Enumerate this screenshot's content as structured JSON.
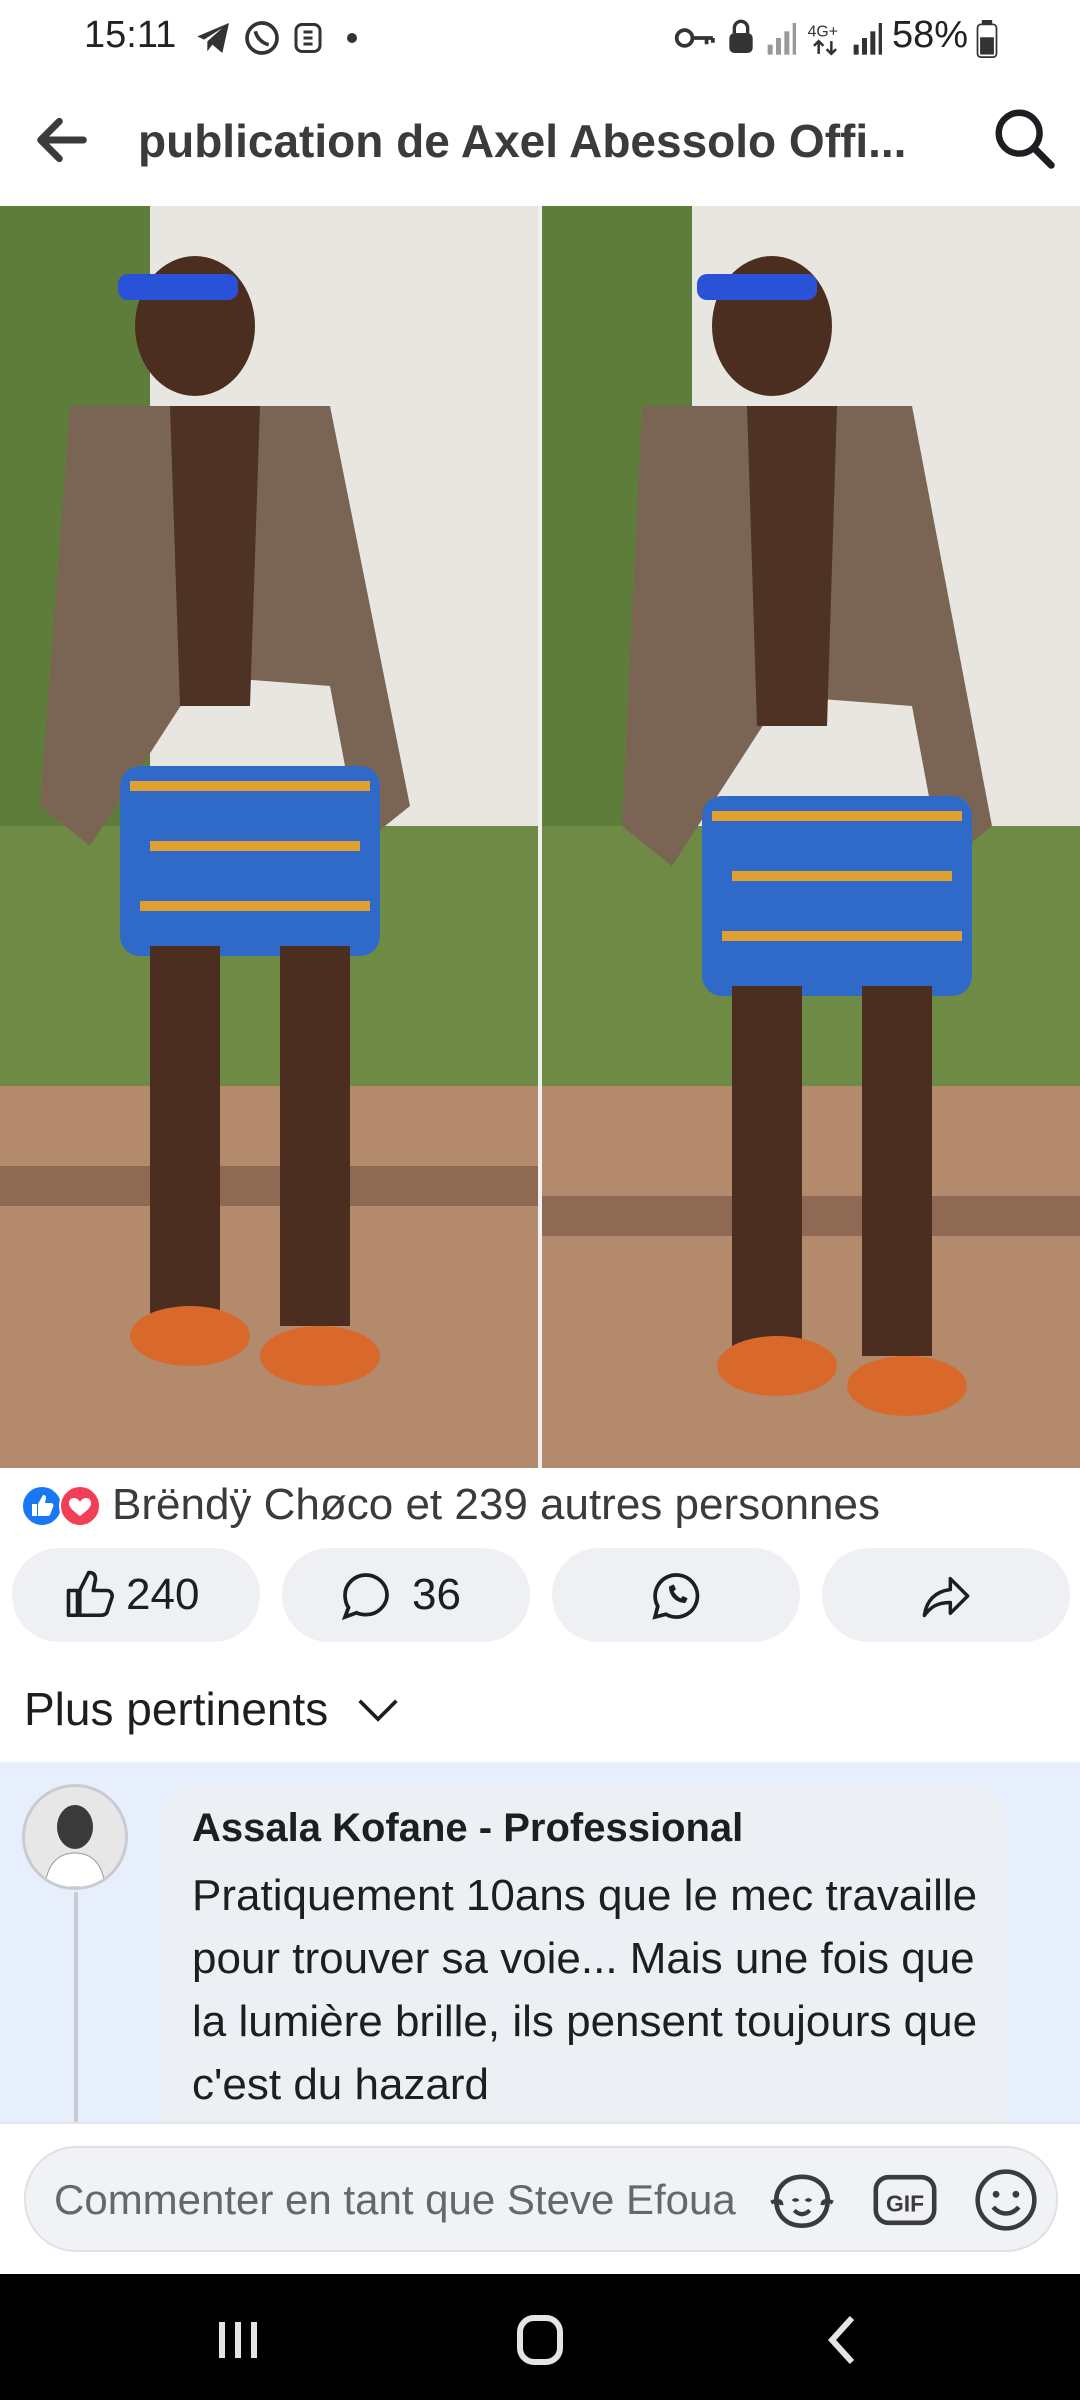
{
  "status_bar": {
    "time": "15:11",
    "battery": "58%",
    "left_icons": [
      "telegram-icon",
      "whatsapp-icon",
      "app-icon",
      "dot-icon"
    ],
    "right_icons": [
      "key-icon",
      "lock-icon",
      "signal-icon",
      "network-4g-icon",
      "signal-icon",
      "battery-icon"
    ]
  },
  "header": {
    "title": "publication de Axel Abessolo Offi...",
    "back_icon": "arrow-left-icon",
    "search_icon": "search-icon"
  },
  "post": {
    "reactions_text": "Brëndÿ Chøco et 239 autres personnes",
    "reaction_types": [
      "like",
      "love"
    ],
    "actions": {
      "like_count": "240",
      "comment_count": "36"
    }
  },
  "comments": {
    "sort_label": "Plus pertinents",
    "items": [
      {
        "author": "Assala Kofane - Professional",
        "text": "Pratiquement 10ans que le mec travaille pour trouver sa voie... Mais une fois que la lumière brille, ils pensent toujours que c'est du hazard"
      }
    ]
  },
  "composer": {
    "placeholder": "Commenter en tant que Steve Efoua",
    "gif_label": "GIF"
  },
  "colors": {
    "facebook_blue": "#1877f2",
    "love_red": "#f33e58",
    "comment_bg": "#e6effb",
    "pill_bg": "#eef0f3"
  }
}
